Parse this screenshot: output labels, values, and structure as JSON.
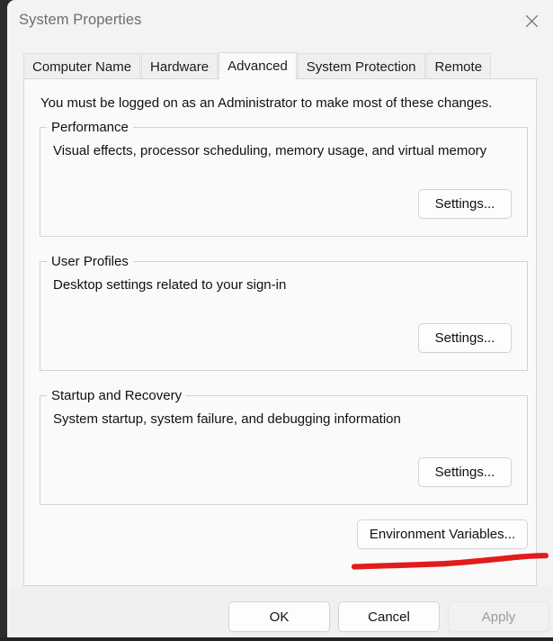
{
  "window": {
    "title": "System Properties",
    "close_icon": "close-icon"
  },
  "tabs": [
    {
      "label": "Computer Name",
      "active": false
    },
    {
      "label": "Hardware",
      "active": false
    },
    {
      "label": "Advanced",
      "active": true
    },
    {
      "label": "System Protection",
      "active": false
    },
    {
      "label": "Remote",
      "active": false
    }
  ],
  "panel": {
    "admin_notice": "You must be logged on as an Administrator to make most of these changes.",
    "groups": [
      {
        "legend": "Performance",
        "description": "Visual effects, processor scheduling, memory usage, and virtual memory",
        "button": "Settings..."
      },
      {
        "legend": "User Profiles",
        "description": "Desktop settings related to your sign-in",
        "button": "Settings..."
      },
      {
        "legend": "Startup and Recovery",
        "description": "System startup, system failure, and debugging information",
        "button": "Settings..."
      }
    ],
    "environment_variables_button": "Environment Variables..."
  },
  "annotation": {
    "type": "hand-drawn-underline",
    "color": "#e21b1b",
    "target": "Environment Variables..."
  },
  "footer": {
    "ok": "OK",
    "cancel": "Cancel",
    "apply": "Apply",
    "apply_disabled": true
  },
  "colors": {
    "desktop": "#2c2c2c",
    "window_bg": "#f3f3f3",
    "panel_bg": "#fafafa",
    "footer_bg": "#f0f0f0",
    "title_text": "#6d6d6d",
    "body_text": "#111111",
    "disabled_text": "#9b9b9b",
    "border": "#d2d2d2",
    "annotation_red": "#e21b1b"
  }
}
